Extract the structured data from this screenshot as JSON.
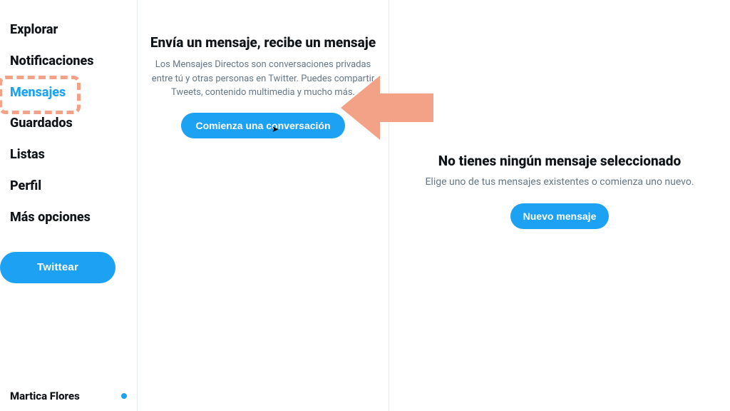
{
  "sidebar": {
    "items": [
      {
        "label": "Explorar"
      },
      {
        "label": "Notificaciones"
      },
      {
        "label": "Mensajes",
        "active": true
      },
      {
        "label": "Guardados"
      },
      {
        "label": "Listas"
      },
      {
        "label": "Perfil"
      },
      {
        "label": "Más opciones"
      }
    ],
    "tweet_label": "Twittear",
    "user_name": "Martica Flores"
  },
  "mid": {
    "title": "Envía un mensaje, recibe un mensaje",
    "description": "Los Mensajes Directos son conversaciones privadas entre tú y otras personas en Twitter. Puedes compartir Tweets, contenido multimedia y mucho más.",
    "start_label": "Comienza una conversación"
  },
  "right": {
    "title": "No tienes ningún mensaje seleccionado",
    "description": "Elige uno de tus mensajes existentes o comienza uno nuevo.",
    "new_label": "Nuevo mensaje"
  },
  "colors": {
    "accent": "#1da1f2",
    "highlight": "#f3a288"
  }
}
